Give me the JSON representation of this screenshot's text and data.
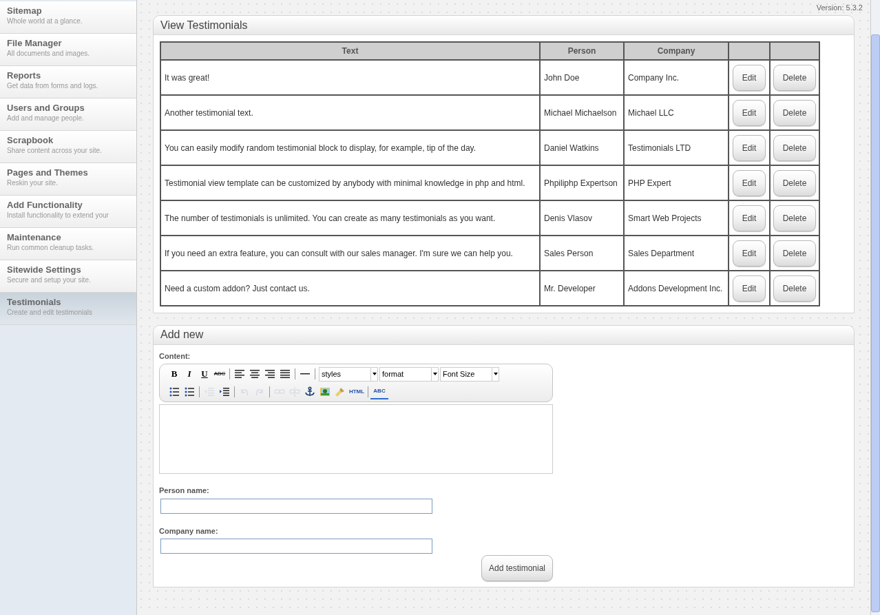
{
  "sidebar": {
    "items": [
      {
        "title": "Sitemap",
        "subtitle": "Whole world at a glance.",
        "selected": false
      },
      {
        "title": "File Manager",
        "subtitle": "All documents and images.",
        "selected": false
      },
      {
        "title": "Reports",
        "subtitle": "Get data from forms and logs.",
        "selected": false
      },
      {
        "title": "Users and Groups",
        "subtitle": "Add and manage people.",
        "selected": false
      },
      {
        "title": "Scrapbook",
        "subtitle": "Share content across your site.",
        "selected": false
      },
      {
        "title": "Pages and Themes",
        "subtitle": "Reskin your site.",
        "selected": false
      },
      {
        "title": "Add Functionality",
        "subtitle": "Install functionality to extend your",
        "selected": false
      },
      {
        "title": "Maintenance",
        "subtitle": "Run common cleanup tasks.",
        "selected": false
      },
      {
        "title": "Sitewide Settings",
        "subtitle": "Secure and setup your site.",
        "selected": false
      },
      {
        "title": "Testimonials",
        "subtitle": "Create and edit testimonials",
        "selected": true
      }
    ]
  },
  "version": "Version: 5.3.2",
  "view_panel": {
    "title": "View Testimonials",
    "columns": [
      "Text",
      "Person",
      "Company"
    ],
    "rows": [
      {
        "text": "It was great!",
        "person": "John Doe",
        "company": "Company Inc.",
        "edit": "Edit",
        "delete": "Delete"
      },
      {
        "text": "Another testimonial text.",
        "person": "Michael Michaelson",
        "company": "Michael LLC",
        "edit": "Edit",
        "delete": "Delete"
      },
      {
        "text": "You can easily modify random testimonial block to display, for example, tip of the day.",
        "person": "Daniel Watkins",
        "company": "Testimonials LTD",
        "edit": "Edit",
        "delete": "Delete"
      },
      {
        "text": "Testimonial view template can be customized by anybody with minimal knowledge in php and html.",
        "person": "Phpiliphp Expertson",
        "company": "PHP Expert",
        "edit": "Edit",
        "delete": "Delete"
      },
      {
        "text": "The number of testimonials is unlimited. You can create as many testimonials as you want.",
        "person": "Denis Vlasov",
        "company": "Smart Web Projects",
        "edit": "Edit",
        "delete": "Delete"
      },
      {
        "text": "If you need an extra feature, you can consult with our sales manager. I'm sure we can help you.",
        "person": "Sales Person",
        "company": "Sales Department",
        "edit": "Edit",
        "delete": "Delete"
      },
      {
        "text": "Need a custom addon? Just contact us.",
        "person": "Mr. Developer",
        "company": "Addons Development Inc.",
        "edit": "Edit",
        "delete": "Delete"
      }
    ]
  },
  "add_panel": {
    "title": "Add new",
    "content_label": "Content:",
    "toolbar_rows": [
      [
        {
          "kind": "bold",
          "label": "B",
          "disabled": false
        },
        {
          "kind": "italic",
          "label": "I",
          "disabled": false
        },
        {
          "kind": "underline",
          "label": "U",
          "disabled": false
        },
        {
          "kind": "strike",
          "label": "ABC",
          "disabled": false
        },
        {
          "kind": "sep"
        },
        {
          "kind": "alignleft",
          "disabled": false
        },
        {
          "kind": "aligncenter",
          "disabled": false
        },
        {
          "kind": "alignright",
          "disabled": false
        },
        {
          "kind": "alignjustify",
          "disabled": false
        },
        {
          "kind": "sep"
        },
        {
          "kind": "rule",
          "disabled": false
        },
        {
          "kind": "sep"
        },
        {
          "kind": "select",
          "label": "styles"
        },
        {
          "kind": "select",
          "label": "format"
        },
        {
          "kind": "select",
          "label": "Font Size"
        }
      ],
      [
        {
          "kind": "bullets",
          "disabled": false
        },
        {
          "kind": "numbers",
          "disabled": false
        },
        {
          "kind": "sep"
        },
        {
          "kind": "outdent",
          "disabled": true
        },
        {
          "kind": "indent",
          "disabled": false
        },
        {
          "kind": "sep"
        },
        {
          "kind": "undo",
          "disabled": true
        },
        {
          "kind": "redo",
          "disabled": true
        },
        {
          "kind": "sep"
        },
        {
          "kind": "link",
          "disabled": true
        },
        {
          "kind": "unlink",
          "disabled": true
        },
        {
          "kind": "anchor",
          "disabled": false
        },
        {
          "kind": "image",
          "disabled": false
        },
        {
          "kind": "cleanup",
          "disabled": false
        },
        {
          "kind": "html",
          "label": "HTML",
          "disabled": false
        },
        {
          "kind": "sep"
        },
        {
          "kind": "spellcheck",
          "label": "ABC",
          "disabled": false
        }
      ]
    ],
    "person_label": "Person name:",
    "company_label": "Company name:",
    "submit": "Add testimonial"
  }
}
